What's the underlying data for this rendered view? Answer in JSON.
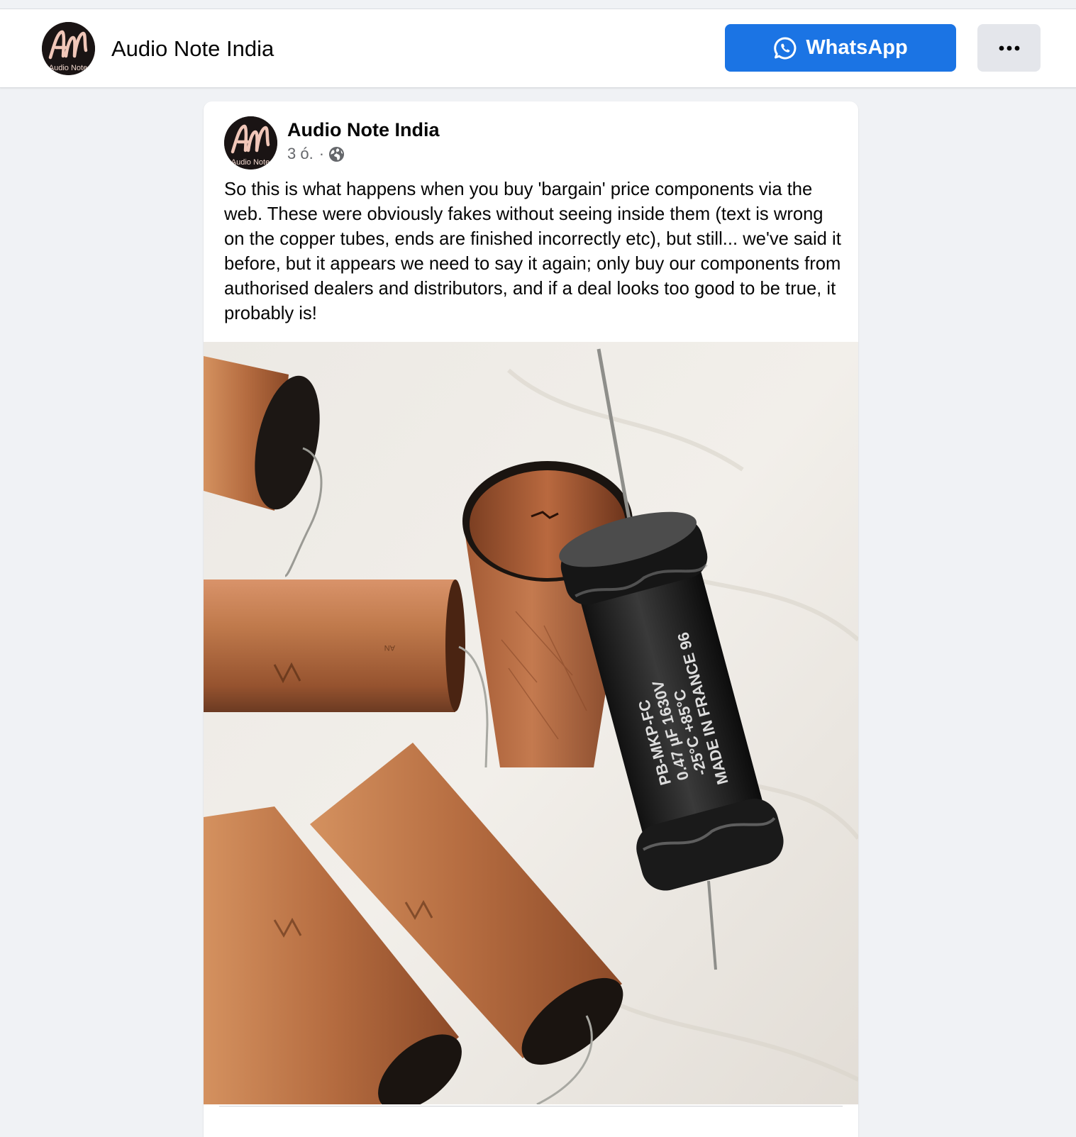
{
  "header": {
    "page_name": "Audio Note India",
    "avatar_logo_text": "AN",
    "avatar_logo_subtext": "Audio Note",
    "whatsapp_label": "WhatsApp",
    "more_icon": "more-horizontal-icon",
    "whatsapp_icon": "whatsapp-icon"
  },
  "post": {
    "author": "Audio Note India",
    "time": "3 ó.",
    "separator": "·",
    "audience_icon": "globe-icon",
    "text": "So this is what happens when you buy 'bargain' price components via the web. These were obviously fakes without seeing inside them (text is wrong on the copper tubes, ends are finished incorrectly etc), but still... we've said it before, but it appears we need to say it again; only buy our components from authorised dealers and distributors, and if a deal looks too good to be true, it probably is!",
    "photo": {
      "capacitor_markings": [
        "PB-MKP-FC",
        "0.47 µF 1630V",
        "-25°C +85°C",
        "MADE IN FRANCE 96"
      ],
      "logo_mark": "AN"
    }
  },
  "colors": {
    "page_background": "#f0f2f5",
    "whatsapp_button": "#1b74e4",
    "more_button": "#e4e6eb",
    "secondary_text": "#65676b",
    "copper": "#b5683a",
    "cloth": "#ece8e2"
  }
}
